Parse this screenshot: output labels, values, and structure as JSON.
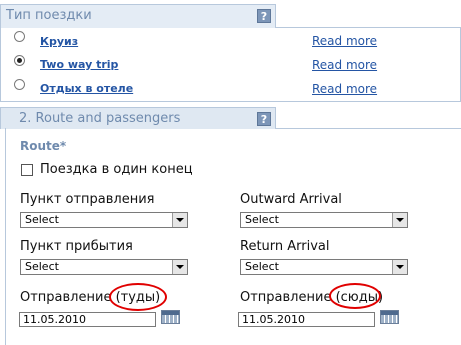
{
  "section1": {
    "title": "Тип поездки",
    "help": "?",
    "options": [
      {
        "label": "Круиз",
        "more": "Read more",
        "checked": false
      },
      {
        "label": "Two way trip",
        "more": "Read more",
        "checked": true
      },
      {
        "label": "Отдых в отеле",
        "more": "Read more",
        "checked": false
      }
    ]
  },
  "section2": {
    "title": "2. Route and passengers",
    "help": "?",
    "route_label": "Route*",
    "one_way_label": "Поездка в один конец",
    "departure_point_label": "Пункт отправления",
    "departure_point_value": "Select",
    "outward_arrival_label": "Outward Arrival",
    "outward_arrival_value": "Select",
    "arrival_point_label": "Пункт прибытия",
    "arrival_point_value": "Select",
    "return_arrival_label": "Return Arrival",
    "return_arrival_value": "Select",
    "departure_there_label": "Отправление (туды)",
    "departure_there_date": "11.05.2010",
    "departure_back_label": "Отправление (сюды)",
    "departure_back_date": "11.05.2010"
  },
  "colors": {
    "link": "#2455a4",
    "header_text": "#6f8aad",
    "annotation": "#e00000"
  }
}
